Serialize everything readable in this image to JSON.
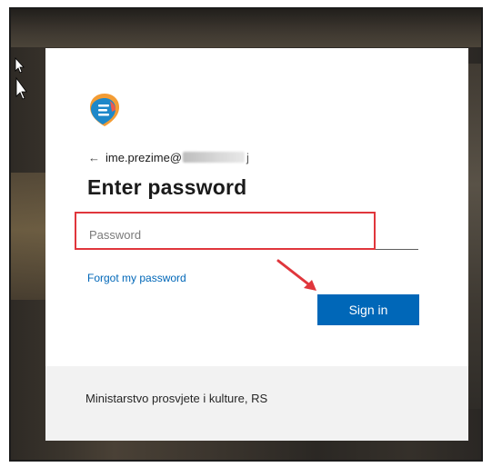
{
  "brand": {
    "accent": "#0067b8",
    "highlight_color": "#e0363c",
    "logo_icon": "org-logo-icon"
  },
  "account": {
    "back_icon": "←",
    "email_visible": "ime.prezime@",
    "email_tail": "j"
  },
  "heading": "Enter password",
  "password_field": {
    "placeholder": "Password",
    "value": ""
  },
  "forgot_link": "Forgot my password",
  "sign_in_button": "Sign in",
  "footer": {
    "text": "Ministarstvo prosvjete i kulture, RS"
  }
}
